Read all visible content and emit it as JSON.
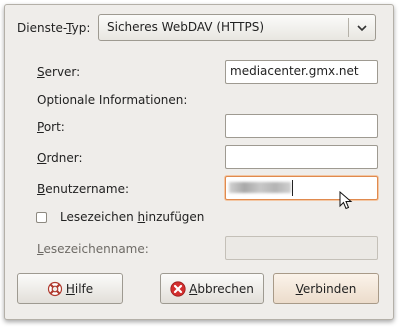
{
  "service_type": {
    "label_pre": "Dienste-",
    "label_mnemonic": "T",
    "label_post": "yp:",
    "value": "Sicheres WebDAV (HTTPS)"
  },
  "server": {
    "label_mnemonic": "S",
    "label_post": "erver:",
    "value": "mediacenter.gmx.net"
  },
  "optional_heading": "Optionale Informationen:",
  "port": {
    "label_mnemonic": "P",
    "label_post": "ort:",
    "value": ""
  },
  "folder": {
    "label_mnemonic": "O",
    "label_post": "rdner:",
    "value": ""
  },
  "username": {
    "label_mnemonic": "B",
    "label_post": "enutzername:"
  },
  "bookmark_checkbox": {
    "label_pre": "Lesezeichen ",
    "label_mnemonic": "h",
    "label_post": "inzufügen",
    "checked": false
  },
  "bookmark_name": {
    "label_mnemonic": "L",
    "label_post": "esezeichenname:",
    "value": ""
  },
  "buttons": {
    "help": {
      "label_mnemonic": "H",
      "label_post": "ilfe",
      "icon": "lifebuoy-icon"
    },
    "cancel": {
      "label_mnemonic": "A",
      "label_post": "bbrechen",
      "icon": "cancel-icon"
    },
    "connect": {
      "label_mnemonic": "V",
      "label_post": "erbinden"
    }
  },
  "colors": {
    "dialog_bg": "#efedea",
    "focus_border": "#e08a4e",
    "cancel_red": "#d32f2f"
  }
}
